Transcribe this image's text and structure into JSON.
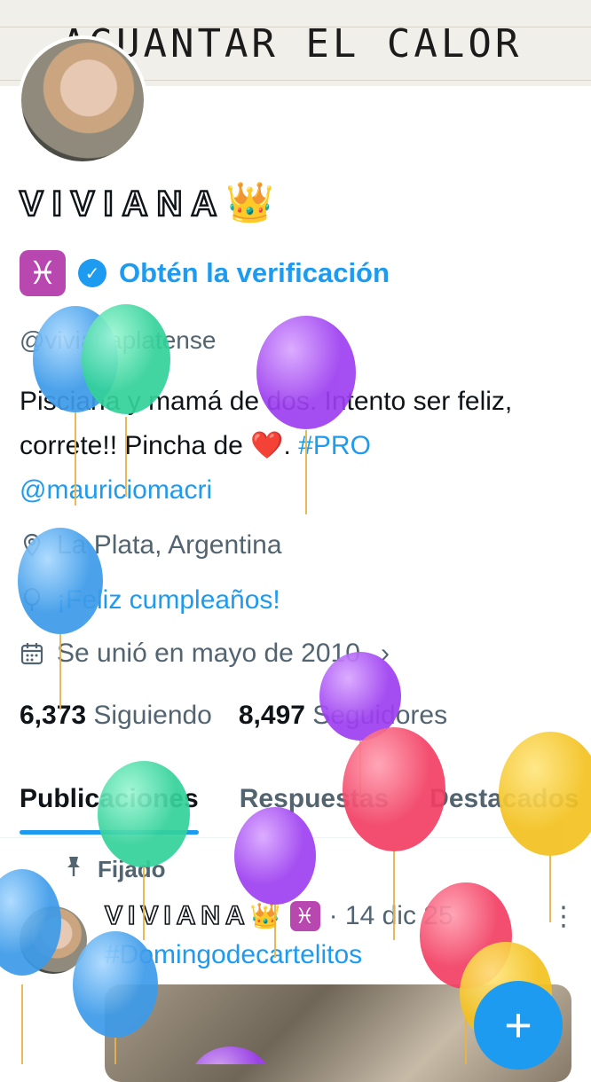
{
  "banner": {
    "text_top": "…",
    "text": "AGUANTAR EL CALOR"
  },
  "profile": {
    "display_name": "VIVIANA",
    "crown_emoji": "👑",
    "pisces_emoji": "♓",
    "verify_label": "Obtén la verificación",
    "handle": "@vivianaplatense",
    "bio": {
      "text1": "Pisciana y mamá de dos. Intento ser feliz, correte!! Pincha de",
      "heart": "❤️",
      "period": ".",
      "hashtag": "#PRO",
      "mention": "@mauriciomacri"
    },
    "location": "La Plata, Argentina",
    "birthday": "¡Feliz cumpleaños!",
    "joined": "Se unió en mayo de 2010",
    "following_count": "6,373",
    "following_label": "Siguiendo",
    "followers_count": "8,497",
    "followers_label": "Seguidores"
  },
  "tabs": [
    "Publicaciones",
    "Respuestas",
    "Destacados"
  ],
  "pinned_post": {
    "pinned_label": "Fijado",
    "author": "VIVIANA",
    "date": "· 14 dic 25",
    "hashtag": "#Domingodecartelitos"
  },
  "fab": {
    "label": "+"
  },
  "colors": {
    "accent": "#1d9bf0",
    "text": "#0f1419",
    "secondary": "#536471",
    "pisces": "#b847b0"
  },
  "icons": [
    "location-icon",
    "balloon-icon",
    "calendar-icon",
    "chevron-right-icon",
    "pin-icon",
    "verified-check-icon",
    "more-icon"
  ]
}
